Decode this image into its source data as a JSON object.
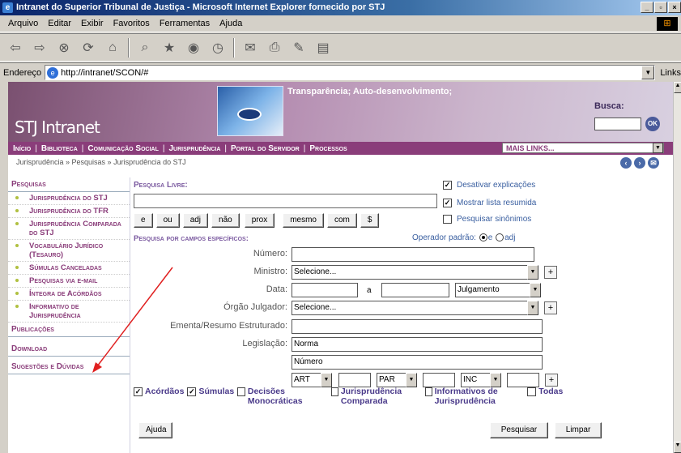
{
  "window": {
    "title": "Intranet do Superior Tribunal de Justiça - Microsoft Internet Explorer fornecido por STJ"
  },
  "menu": [
    "Arquivo",
    "Editar",
    "Exibir",
    "Favoritos",
    "Ferramentas",
    "Ajuda"
  ],
  "address": {
    "label": "Endereço",
    "url": "http://intranet/SCON/#",
    "links": "Links"
  },
  "banner": {
    "logo": "STJ Intranet",
    "slogan": "Transparência; Auto-desenvolvimento;",
    "busca_label": "Busca:",
    "ok_label": "OK"
  },
  "topnav": {
    "items": [
      "Início",
      "Biblioteca",
      "Comunicação Social",
      "Jurisprudência",
      "Portal do Servidor",
      "Processos"
    ],
    "more": "MAIS LINKS..."
  },
  "breadcrumb": "Jurisprudência » Pesquisas » Jurisprudência do STJ",
  "leftnav": {
    "pesquisas": "Pesquisas",
    "items": [
      "Jurisprudência do STJ",
      "Jurisprudência do TFR",
      "Jurisprudência Comparada do STJ",
      "Vocabulário Jurídico (Tesauro)",
      "Súmulas Canceladas",
      "Pesquisas via e-mail",
      "Íntegra de Acórdãos",
      "Informativo de Jurisprudência"
    ],
    "publicacoes": "Publicações",
    "download": "Download",
    "sugestoes": "Sugestões e Dúvidas"
  },
  "form": {
    "pesquisa_livre": "Pesquisa Livre:",
    "operators": [
      "e",
      "ou",
      "adj",
      "não",
      "prox",
      "mesmo",
      "com",
      "$"
    ],
    "options": [
      {
        "label": "Desativar explicações",
        "checked": true
      },
      {
        "label": "Mostrar lista resumida",
        "checked": true
      },
      {
        "label": "Pesquisar sinônimos",
        "checked": false
      }
    ],
    "campos_label": "Pesquisa por campos específicos:",
    "operador_padrao": "Operador padrão:",
    "op_e": "e",
    "op_adj": "adj",
    "numero_label": "Número:",
    "ministro_label": "Ministro:",
    "ministro_value": "Selecione...",
    "data_label": "Data:",
    "data_a": "a",
    "data_tipo": "Julgamento",
    "orgao_label": "Órgão Julgador:",
    "orgao_value": "Selecione...",
    "ementa_label": "Ementa/Resumo Estruturado:",
    "legislacao_label": "Legislação:",
    "legislacao_value": "Norma",
    "numero_placeholder": "Número",
    "art": "ART",
    "par": "PAR",
    "inc": "INC",
    "plus": "+",
    "checkboxes": [
      {
        "label": "Acórdãos",
        "checked": true
      },
      {
        "label": "Súmulas",
        "checked": true
      },
      {
        "label": "Decisões Monocráticas",
        "checked": false
      },
      {
        "label": "Jurisprudência Comparada",
        "checked": false
      },
      {
        "label": "Informativos de Jurisprudência",
        "checked": false
      },
      {
        "label": "Todas",
        "checked": false
      }
    ],
    "ajuda": "Ajuda",
    "pesquisar": "Pesquisar",
    "limpar": "Limpar"
  },
  "colors": {
    "brand": "#8a3d7a",
    "link": "#3a5fa0",
    "arrow": "#e02020"
  }
}
